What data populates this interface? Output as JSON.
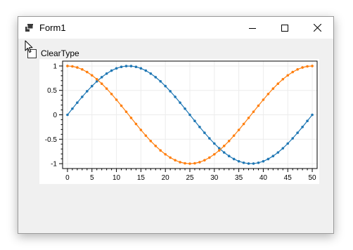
{
  "window": {
    "title": "Form1",
    "controls": {
      "minimize": "minimize-icon",
      "maximize": "maximize-icon",
      "close": "close-icon"
    }
  },
  "checkbox": {
    "label": "ClearType",
    "checked": false
  },
  "chart_data": {
    "type": "line",
    "title": "",
    "xlabel": "",
    "ylabel": "",
    "xlim": [
      -1,
      51
    ],
    "ylim": [
      -1.1,
      1.1
    ],
    "grid": true,
    "x_ticks": [
      "0",
      "5",
      "10",
      "15",
      "20",
      "25",
      "30",
      "35",
      "40",
      "45",
      "50"
    ],
    "y_ticks": [
      "1",
      "0.5",
      "0",
      "-0.5",
      "-1"
    ],
    "x": [
      0,
      1,
      2,
      3,
      4,
      5,
      6,
      7,
      8,
      9,
      10,
      11,
      12,
      13,
      14,
      15,
      16,
      17,
      18,
      19,
      20,
      21,
      22,
      23,
      24,
      25,
      26,
      27,
      28,
      29,
      30,
      31,
      32,
      33,
      34,
      35,
      36,
      37,
      38,
      39,
      40,
      41,
      42,
      43,
      44,
      45,
      46,
      47,
      48,
      49,
      50
    ],
    "series": [
      {
        "color": "#1f77b4",
        "values": [
          0,
          0.125,
          0.249,
          0.368,
          0.482,
          0.588,
          0.685,
          0.771,
          0.844,
          0.905,
          0.951,
          0.982,
          0.998,
          0.998,
          0.982,
          0.951,
          0.905,
          0.844,
          0.771,
          0.685,
          0.588,
          0.482,
          0.368,
          0.249,
          0.125,
          0,
          -0.125,
          -0.249,
          -0.368,
          -0.482,
          -0.588,
          -0.685,
          -0.771,
          -0.844,
          -0.905,
          -0.951,
          -0.982,
          -0.998,
          -0.998,
          -0.982,
          -0.951,
          -0.905,
          -0.844,
          -0.771,
          -0.685,
          -0.588,
          -0.482,
          -0.368,
          -0.249,
          -0.125,
          0
        ]
      },
      {
        "color": "#ff7f0e",
        "values": [
          1,
          0.992,
          0.969,
          0.93,
          0.876,
          0.809,
          0.729,
          0.637,
          0.536,
          0.426,
          0.309,
          0.187,
          0.063,
          -0.063,
          -0.187,
          -0.309,
          -0.426,
          -0.536,
          -0.637,
          -0.729,
          -0.809,
          -0.876,
          -0.93,
          -0.969,
          -0.992,
          -1,
          -0.992,
          -0.969,
          -0.93,
          -0.876,
          -0.809,
          -0.729,
          -0.637,
          -0.536,
          -0.426,
          -0.309,
          -0.187,
          -0.063,
          0.063,
          0.187,
          0.309,
          0.426,
          0.536,
          0.637,
          0.729,
          0.809,
          0.876,
          0.93,
          0.969,
          0.992,
          1
        ]
      }
    ]
  }
}
